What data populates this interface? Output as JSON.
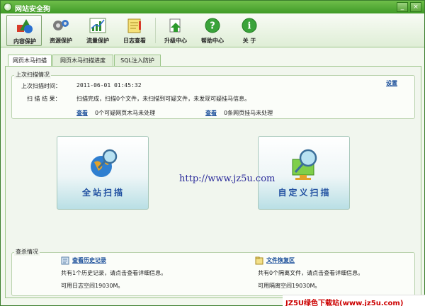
{
  "window": {
    "title": "网站安全狗",
    "min_label": "_",
    "close_label": "×"
  },
  "toolbar": {
    "items": [
      {
        "label": "内容保护",
        "icon": "shapes-icon",
        "active": true
      },
      {
        "label": "资源保护",
        "icon": "gears-icon"
      },
      {
        "label": "流量保护",
        "icon": "chart-icon"
      },
      {
        "label": "日志查看",
        "icon": "notebook-icon"
      },
      {
        "label": "升级中心",
        "icon": "upgrade-icon"
      },
      {
        "label": "帮助中心",
        "icon": "help-icon"
      },
      {
        "label": "关 于",
        "icon": "info-icon"
      }
    ]
  },
  "tabs": [
    "网页木马扫描",
    "网页木马扫描进度",
    "SQL注入防护"
  ],
  "last_scan": {
    "group_title": "上次扫描情况",
    "time_label": "上次扫描时间：",
    "time_value": "2011-06-01 01:45:32",
    "settings_link": "设置",
    "result_label": "扫 描 结 果：",
    "result_value": "扫描完成，扫描0个文件，未扫描到可疑文件，未发现可疑挂马信息。",
    "view1": "查看",
    "view1_text": "0个可疑网页木马未处理",
    "view2": "查看",
    "view2_text": "0条网页挂马未处理"
  },
  "buttons": {
    "full_scan": "全站扫描",
    "custom_scan": "自定义扫描"
  },
  "watermark": "http://www.jz5u.com",
  "kill": {
    "group_title": "查杀情况",
    "history_link": "查看历史记录",
    "history_text1": "共有1个历史记录，请点击查看详细信息。",
    "history_text2": "可用日志空间19030M。",
    "restore_link": "文件恢复区",
    "restore_text1": "共有0个隔离文件，请点击查看详细信息。",
    "restore_text2": "可用隔离空间19030M。"
  },
  "footer_brand": "JZ5U绿色下载站(www.jz5u.com)"
}
